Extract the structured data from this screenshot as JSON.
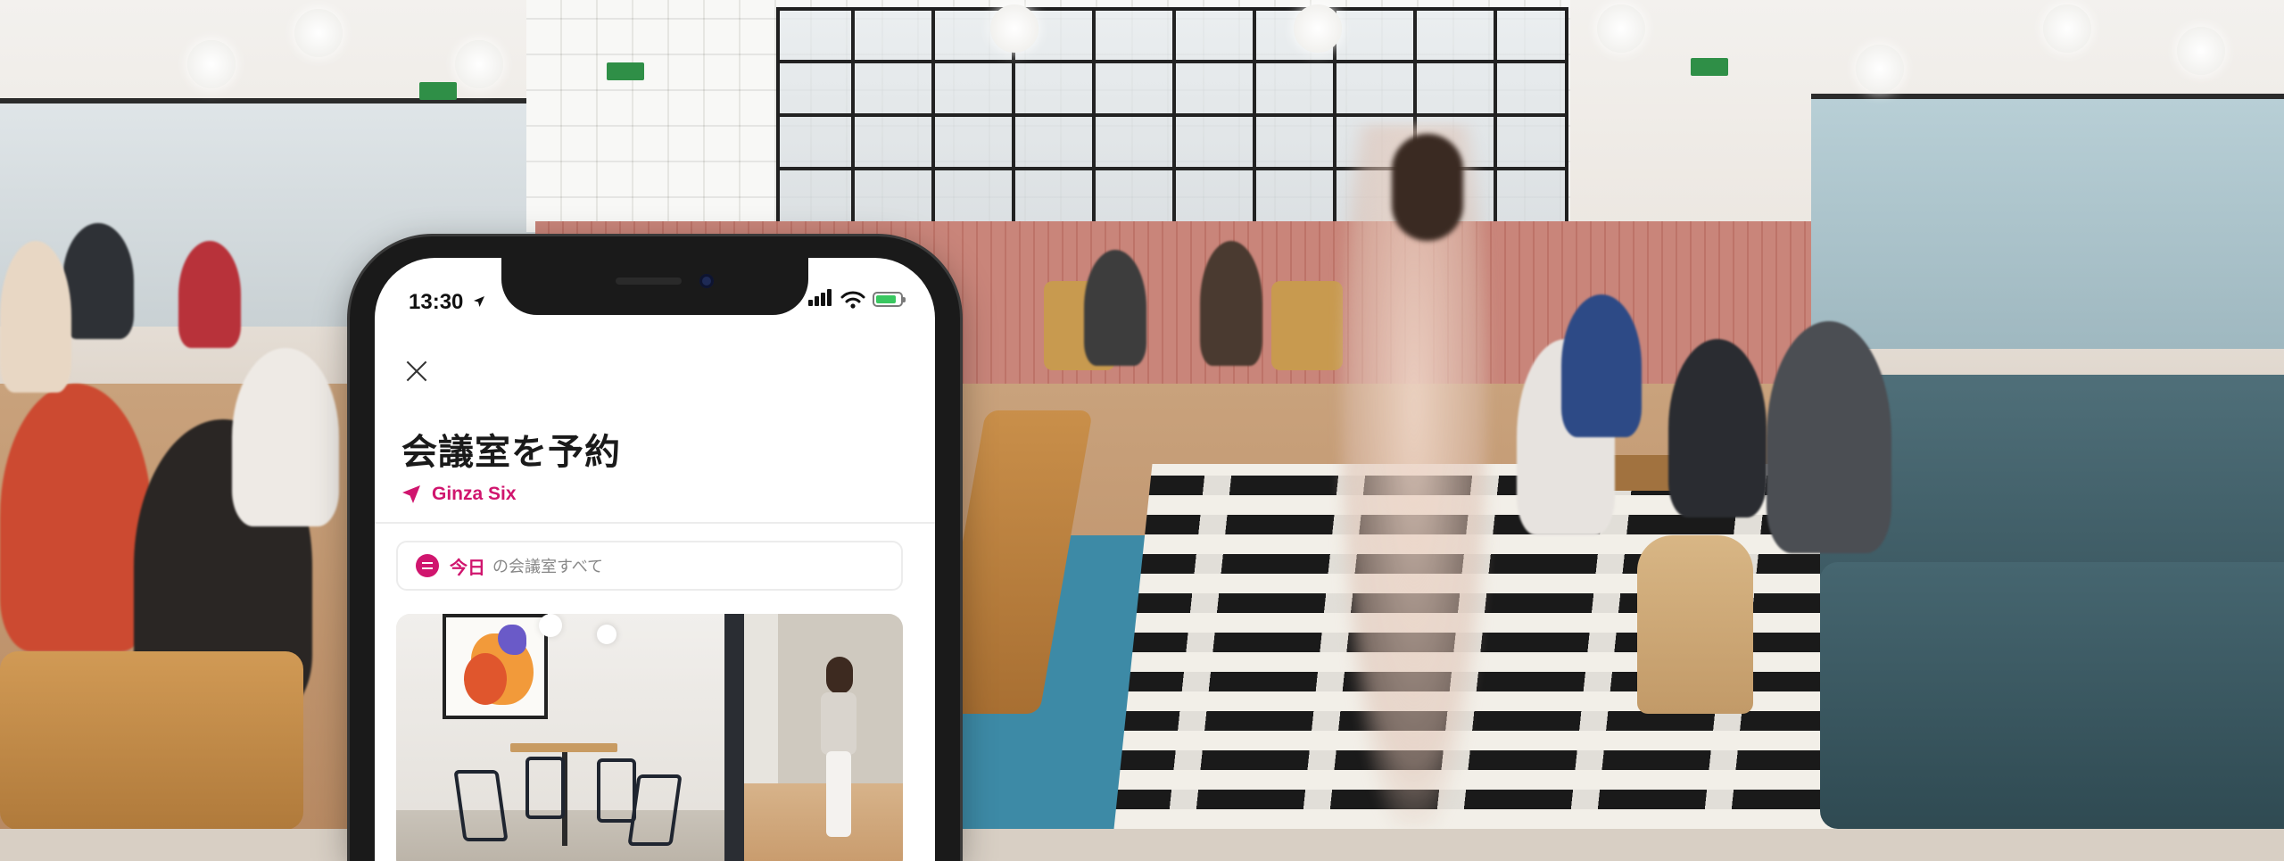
{
  "phone": {
    "status_bar": {
      "time": "13:30",
      "location_arrow_icon": "location-arrow-icon",
      "signal_icon": "signal-bars-icon",
      "wifi_icon": "wifi-icon",
      "battery_icon": "battery-charging-icon",
      "battery_color": "#39c760"
    },
    "header": {
      "close_icon": "close-icon",
      "title": "会議室を予約"
    },
    "location": {
      "icon": "location-arrow-icon",
      "name": "Ginza Six",
      "accent_color": "#d0156e"
    },
    "filter": {
      "icon": "filter-lines-icon",
      "today_label": "今日",
      "rest_label": "の会議室すべて"
    },
    "card": {
      "image": "meeting-room-photo"
    }
  }
}
